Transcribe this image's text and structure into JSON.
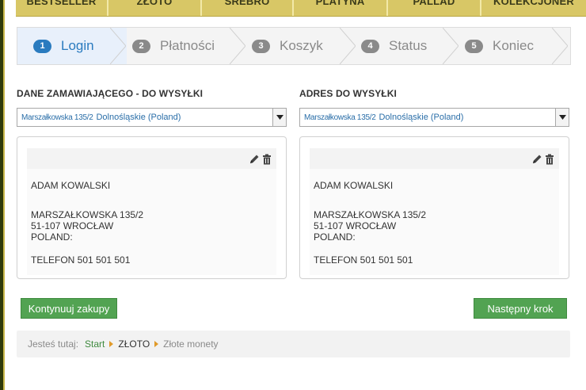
{
  "nav": {
    "items": [
      "BESTSELLER",
      "ZŁOTO",
      "SREBRO",
      "PLATYNA",
      "PALLAD",
      "KOLEKCJONER"
    ]
  },
  "steps": [
    {
      "num": "1",
      "label": "Login",
      "active": true
    },
    {
      "num": "2",
      "label": "Płatności",
      "active": false
    },
    {
      "num": "3",
      "label": "Koszyk",
      "active": false
    },
    {
      "num": "4",
      "label": "Status",
      "active": false
    },
    {
      "num": "5",
      "label": "Koniec",
      "active": false
    }
  ],
  "orderer": {
    "title": "DANE ZAMAWIAJĄCEGO - DO WYSYŁKI",
    "select_street": "Marszałkowska 135/2",
    "select_region": "Dolnośląskie (Poland)",
    "name": "ADAM KOWALSKI",
    "street": "MARSZAŁKOWSKA 135/2",
    "city": "51-107 WROCŁAW",
    "country": "POLAND:",
    "phone": "TELEFON 501 501 501"
  },
  "shipping": {
    "title": "ADRES DO WYSYŁKI",
    "select_street": "Marszałkowska 135/2",
    "select_region": "Dolnośląskie (Poland)",
    "name": "ADAM KOWALSKI",
    "street": "MARSZAŁKOWSKA 135/2",
    "city": "51-107 WROCŁAW",
    "country": "POLAND:",
    "phone": "TELEFON 501 501 501"
  },
  "buttons": {
    "continue_shopping": "Kontynuuj zakupy",
    "next_step": "Następny krok"
  },
  "breadcrumb": {
    "prefix": "Jesteś tutaj:",
    "items": [
      "Start",
      "ZŁOTO",
      "Złote monety"
    ]
  },
  "colors": {
    "nav_bg": "#d8c766",
    "active_step": "#2a7bbf",
    "button_green": "#52a352",
    "breadcrumb_arrow": "#e09a2a"
  },
  "icons": [
    "pencil-icon",
    "trash-icon",
    "dropdown-arrow-icon",
    "breadcrumb-arrow-icon"
  ]
}
